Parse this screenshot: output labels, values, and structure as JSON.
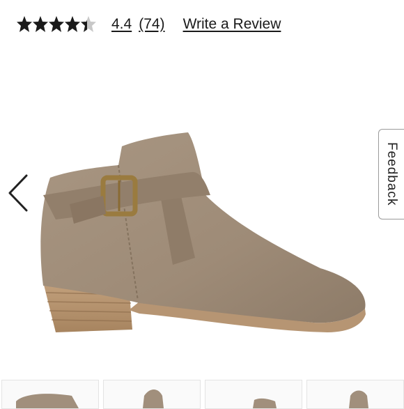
{
  "rating": {
    "value": "4.4",
    "count_label": "(74)",
    "stars": 4.4,
    "max_stars": 5,
    "write_review_label": "Write a Review"
  },
  "feedback_label": "Feedback",
  "icons": {
    "prev": "chevron-left-icon",
    "star": "star-icon"
  },
  "colors": {
    "star_filled": "#1a1a1a",
    "star_empty": "#c8c8c8",
    "boot_taupe": "#a18f7c",
    "boot_strap": "#8f7c68",
    "heel_wood": "#b69573",
    "buckle_brass": "#9a7b3f"
  },
  "thumbnails": [
    "boot side view",
    "boot front view",
    "boot heel view",
    "boot back view"
  ]
}
